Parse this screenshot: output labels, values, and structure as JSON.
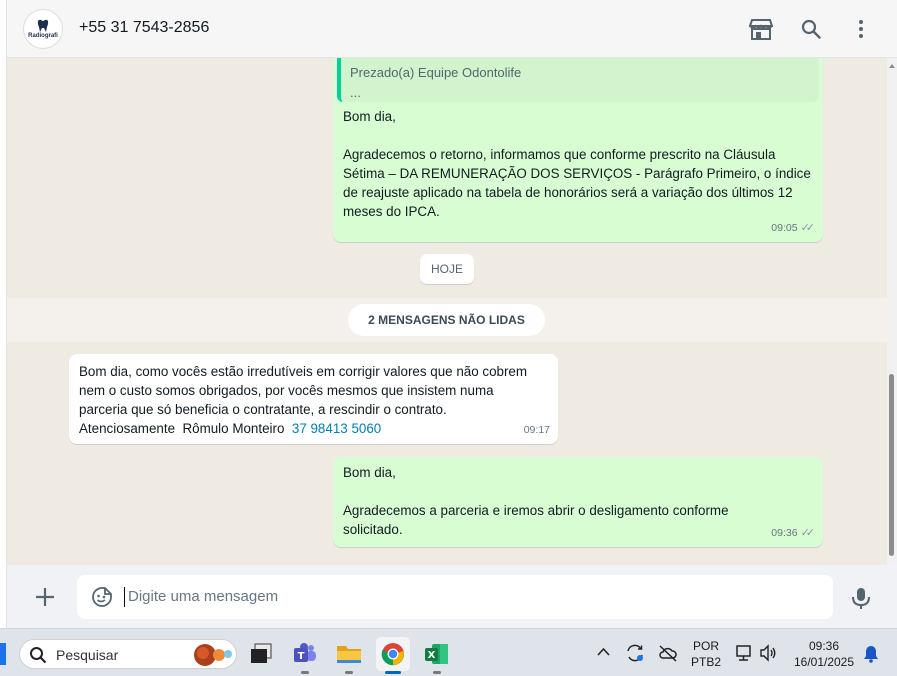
{
  "header": {
    "avatar_text": "Radiografi",
    "contact_name": "+55 31 7543-2856",
    "icons": [
      "store-icon",
      "search-icon",
      "more-vertical-icon"
    ]
  },
  "chat": {
    "quoted": {
      "text": "Prezado(a) Equipe Odontolife\n..."
    },
    "messages": [
      {
        "direction": "out",
        "text": "Bom dia,\n\nAgradecemos o retorno, informamos que conforme prescrito na Cláusula\nSétima – DA REMUNERAÇÃO DOS SERVIÇOS - Parágrafo Primeiro, o índice\nde reajuste aplicado na tabela de honorários será a variação dos últimos 12\nmeses do IPCA.",
        "time": "09:05",
        "ticks": "✓✓"
      },
      {
        "direction": "in",
        "text": "Bom dia, como vocês estão irredutíveis em corrigir valores que não cobrem\nnem o custo somos obrigados, por vocês mesmos que insistem numa\nparceria que só beneficia o contratante, a rescindir o contrato.\nAtenciosamente  Rômulo Monteiro  ",
        "link": "37 98413 5060",
        "time": "09:17"
      },
      {
        "direction": "out",
        "text": "Bom dia,\n\nAgradecemos a parceria e iremos abrir o desligamento conforme\nsolicitado.",
        "time": "09:36",
        "ticks": "✓✓"
      }
    ],
    "day_chip": "HOJE",
    "unread_chip": "2 MENSAGENS NÃO LIDAS"
  },
  "composer": {
    "placeholder": "Digite uma mensagem"
  },
  "taskbar": {
    "search_placeholder": "Pesquisar",
    "apps": [
      "file-viewer-icon",
      "teams-icon",
      "file-explorer-icon",
      "chrome-icon",
      "excel-icon"
    ],
    "language_line1": "POR",
    "language_line2": "PTB2",
    "time": "09:36",
    "date": "16/01/2025"
  },
  "colors": {
    "outgoing_bubble": "#d9fdd3",
    "incoming_bubble": "#ffffff",
    "chat_background": "#efeae2",
    "quote_bar": "#06cf9c",
    "link": "#027eb5"
  }
}
